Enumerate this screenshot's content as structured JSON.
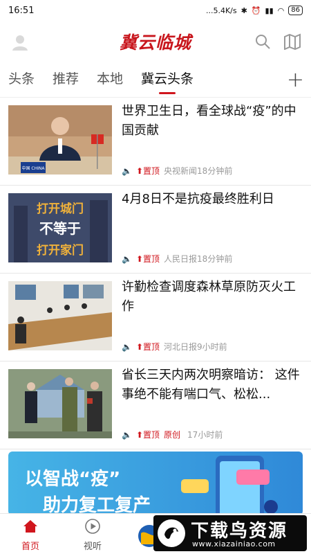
{
  "status": {
    "time": "16:51",
    "net": "...5.4K/s",
    "battery": "86"
  },
  "header": {
    "logo": "冀云临城"
  },
  "tabs": [
    "头条",
    "推荐",
    "本地",
    "冀云头条"
  ],
  "tabs_plus": "+",
  "news": [
    {
      "title": "世界卫生日，看全球战“疫”的中国贡献",
      "pin": "置顶",
      "source": "央视新闻",
      "time": "18分钟前",
      "thumb_caption": "中国 CHINA"
    },
    {
      "title": "4月8日不是抗疫最终胜利日",
      "pin": "置顶",
      "source": "人民日报",
      "time": "18分钟前",
      "thumb_lines": [
        "打开城门",
        "不等于",
        "打开家门"
      ]
    },
    {
      "title": "许勤检查调度森林草原防灭火工作",
      "pin": "置顶",
      "source": "河北日报",
      "time": "9小时前"
    },
    {
      "title": "省长三天内两次明察暗访： 这件事绝不能有喘口气、松松...",
      "pin": "置顶",
      "source": "原创",
      "time": "17小时前"
    }
  ],
  "banner": {
    "line1": "以智战“疫”",
    "line2": "助力复工复产"
  },
  "bottom_nav": [
    {
      "label": "首页"
    },
    {
      "label": "视听"
    }
  ],
  "watermark": {
    "title": "下载鸟资源",
    "url": "www.xiazainiao.com"
  },
  "colors": {
    "brand": "#c8161d",
    "accent": "#d0161d"
  }
}
